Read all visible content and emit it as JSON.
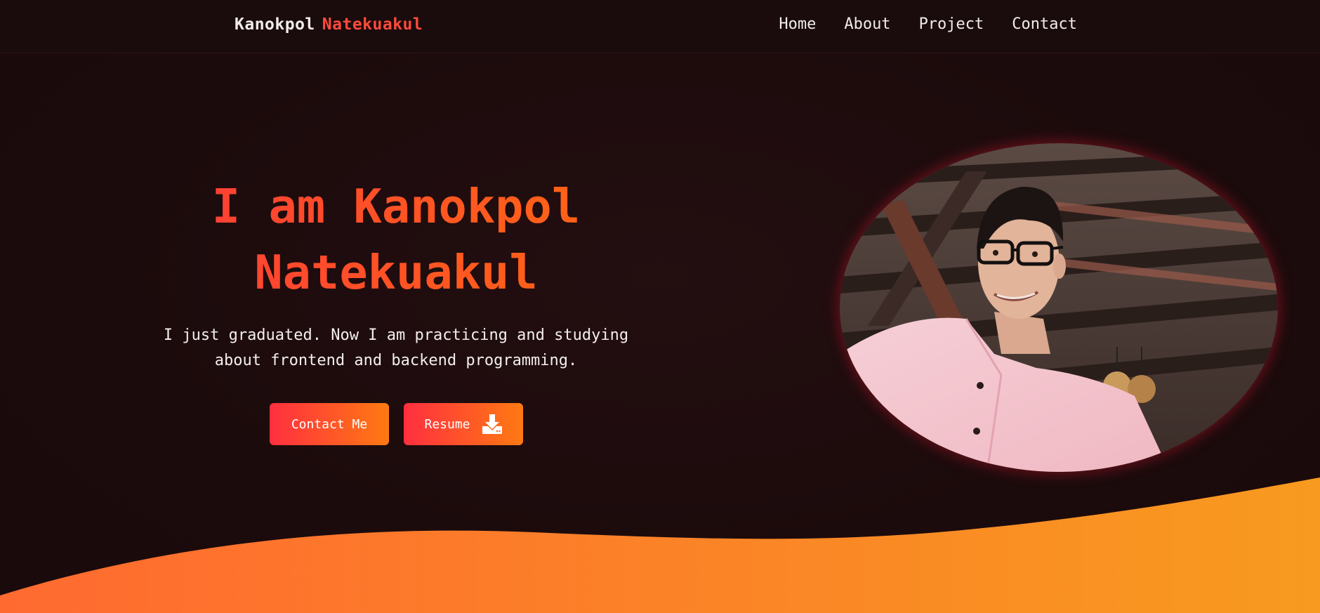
{
  "nav": {
    "brand_first": "Kanokpol",
    "brand_last": "Natekuakul",
    "links": [
      "Home",
      "About",
      "Project",
      "Contact"
    ]
  },
  "hero": {
    "title_line1": "I am Kanokpol",
    "title_line2": "Natekuakul",
    "subtitle_line1": "I just graduated. Now I am practicing and studying",
    "subtitle_line2": "about frontend and backend programming.",
    "contact_label": "Contact Me",
    "resume_label": "Resume",
    "resume_icon": "download-icon"
  },
  "colors": {
    "background": "#1c0c0d",
    "accent_red": "#ff3a3a",
    "accent_orange": "#ff7a12",
    "wave_start": "#ff6a30",
    "wave_end": "#f89a1f"
  }
}
